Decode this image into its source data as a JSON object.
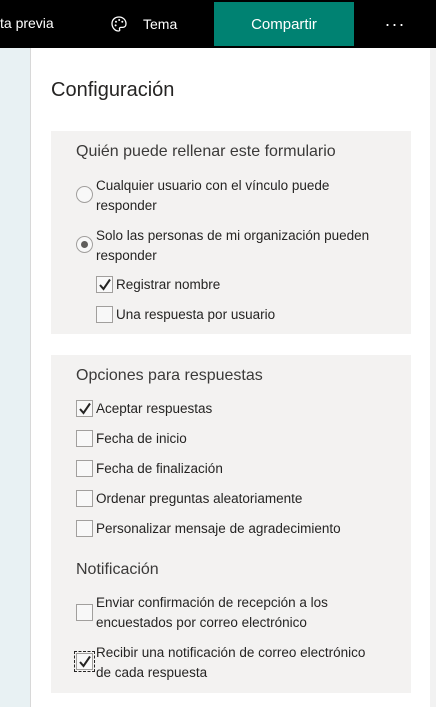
{
  "topbar": {
    "preview_label": "ta previa",
    "theme_label": "Tema",
    "theme_icon": "palette-icon",
    "share_label": "Compartir",
    "share_color": "#008272",
    "more_label": "···"
  },
  "panel": {
    "title": "Configuración",
    "who_fills": {
      "title": "Quién puede rellenar este formulario",
      "options": [
        {
          "line1": "Cualquier usuario con el vínculo puede",
          "line2": "responder",
          "selected": false
        },
        {
          "line1": "Solo las personas de mi organización pueden",
          "line2": "responder",
          "selected": true
        }
      ],
      "record_name": {
        "label": "Registrar nombre",
        "checked": true
      },
      "one_response": {
        "label": "Una respuesta por usuario",
        "checked": false
      }
    },
    "response_options": {
      "title": "Opciones para respuestas",
      "items": [
        {
          "label": "Aceptar respuestas",
          "checked": true
        },
        {
          "label": "Fecha de inicio",
          "checked": false
        },
        {
          "label": "Fecha de finalización",
          "checked": false
        },
        {
          "label": "Ordenar preguntas aleatoriamente",
          "checked": false
        },
        {
          "label": "Personalizar mensaje de agradecimiento",
          "checked": false
        }
      ]
    },
    "notification": {
      "title": "Notificación",
      "items": [
        {
          "line1": "Enviar confirmación de recepción a los",
          "line2": "encuestados por correo electrónico",
          "checked": false
        },
        {
          "line1": "Recibir una notificación de correo electrónico",
          "line2": "de cada respuesta",
          "checked": true
        }
      ]
    }
  }
}
